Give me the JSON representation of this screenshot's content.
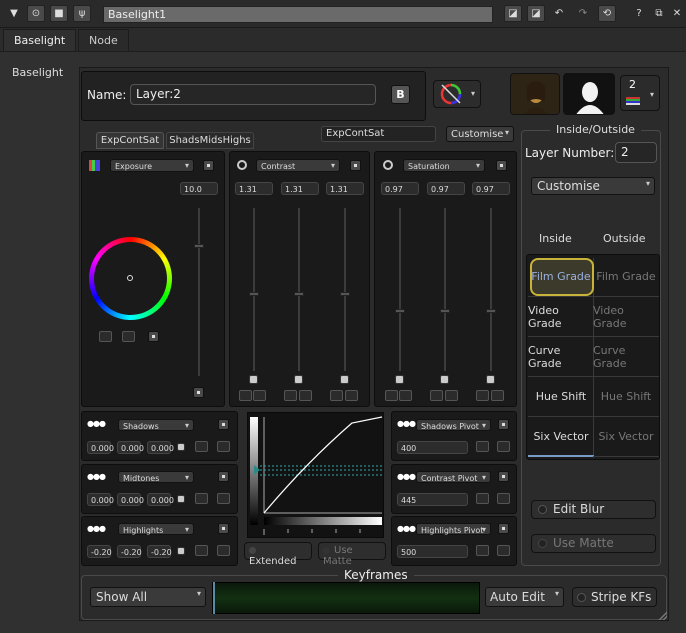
{
  "window": {
    "title": "Baselight1"
  },
  "tabs": [
    {
      "label": "Baselight"
    },
    {
      "label": "Node"
    }
  ],
  "side": {
    "label": "Baselight"
  },
  "header": {
    "name_label": "Name:",
    "name_value": "Layer:2",
    "b_button": "B",
    "layer_count": "2"
  },
  "groups": {
    "tab1": "ExpContSat",
    "tab2": "ShadsMidsHighs",
    "current": "ExpContSat",
    "customise": "Customise"
  },
  "exposure": {
    "label": "Exposure",
    "value": "10.0"
  },
  "contrast": {
    "label": "Contrast",
    "values": [
      "1.31",
      "1.31",
      "1.31"
    ]
  },
  "saturation": {
    "label": "Saturation",
    "values": [
      "0.97",
      "0.97",
      "0.97"
    ]
  },
  "shadows": {
    "label": "Shadows",
    "values": [
      "0.000",
      "0.000",
      "0.000"
    ]
  },
  "midtones": {
    "label": "Midtones",
    "values": [
      "0.000",
      "0.000",
      "0.000"
    ]
  },
  "highlights": {
    "label": "Highlights",
    "values": [
      "-0.20",
      "-0.20",
      "-0.20"
    ]
  },
  "shadows_pivot": {
    "label": "Shadows Pivot",
    "value": "400"
  },
  "contrast_pivot": {
    "label": "Contrast Pivot",
    "value": "445"
  },
  "highlights_pivot": {
    "label": "Highlights Pivot",
    "value": "500"
  },
  "curve": {
    "extended": "Extended",
    "use_matte": "Use Matte"
  },
  "inout": {
    "title": "Inside/Outside",
    "layer_number_label": "Layer Number:",
    "layer_number": "2",
    "customise": "Customise",
    "inside": "Inside",
    "outside": "Outside",
    "grades": [
      "Film Grade",
      "Video Grade",
      "Curve Grade",
      "Hue Shift",
      "Six Vector"
    ],
    "edit_blur": "Edit Blur",
    "use_matte": "Use Matte"
  },
  "keyframes": {
    "title": "Keyframes",
    "show": "Show All",
    "auto_edit": "Auto Edit",
    "stripe": "Stripe KFs"
  },
  "colors": {
    "accent": "#c8b43a",
    "timeline": "#123012"
  }
}
